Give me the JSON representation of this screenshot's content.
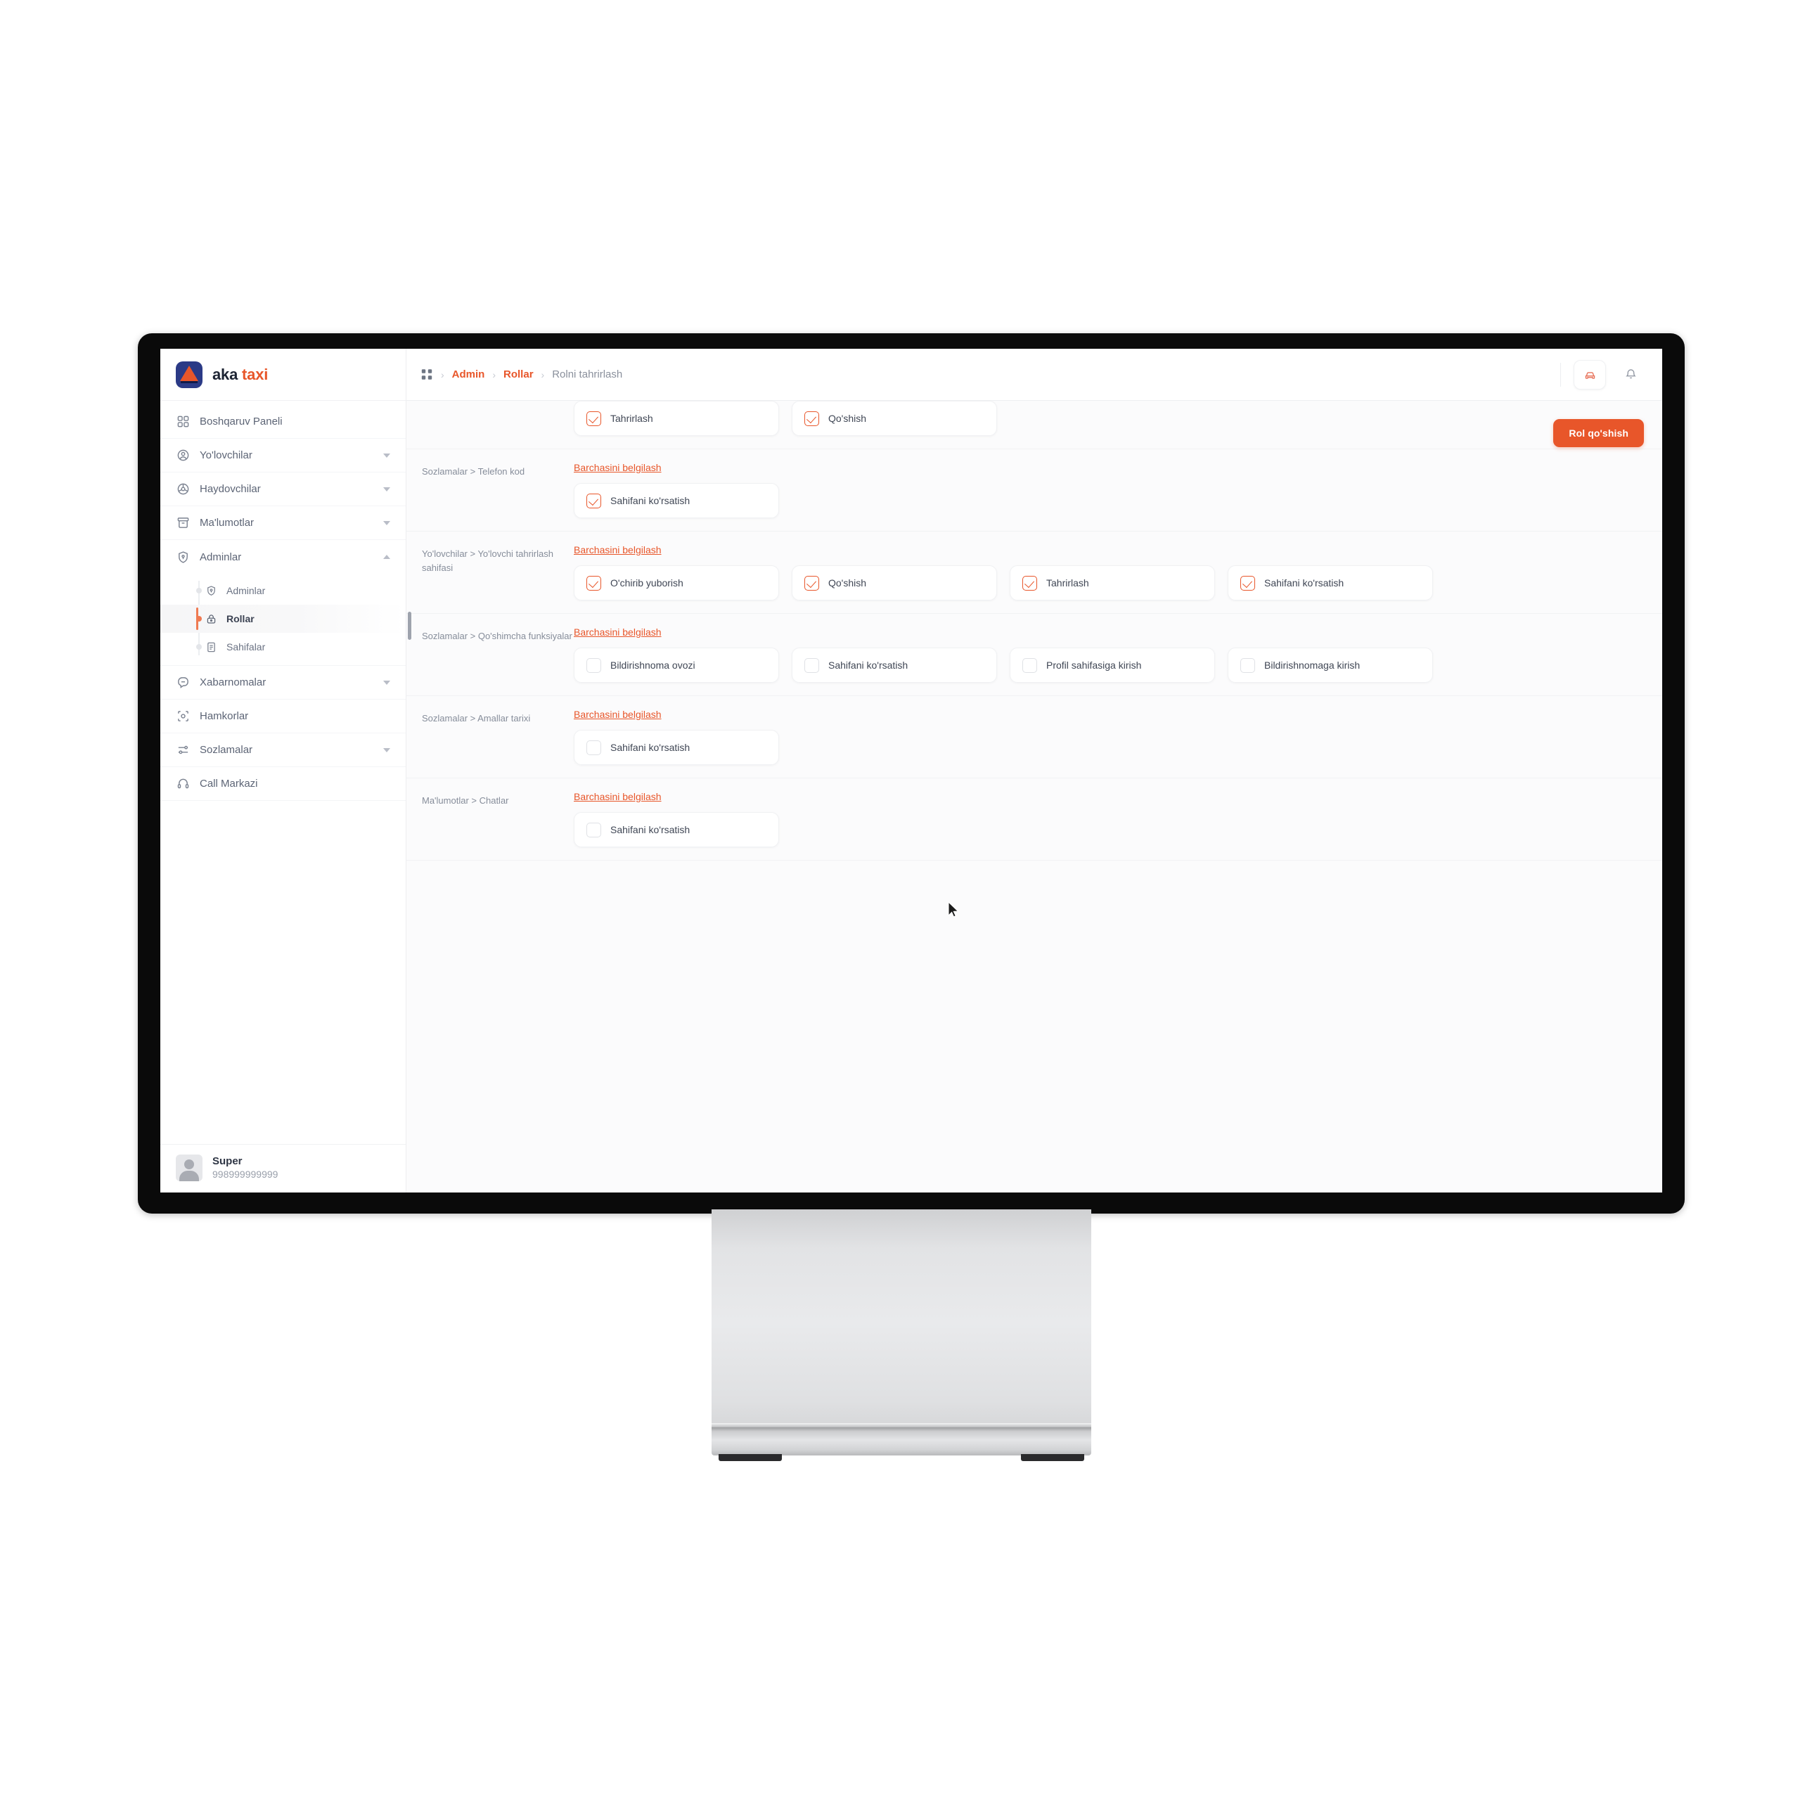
{
  "brand": {
    "word1": "aka",
    "word2": "taxi"
  },
  "sidebar": {
    "items": [
      {
        "label": "Boshqaruv Paneli",
        "icon": "grid-icon",
        "caret": "none"
      },
      {
        "label": "Yo'lovchilar",
        "icon": "user-circle-icon",
        "caret": "down"
      },
      {
        "label": "Haydovchilar",
        "icon": "steering-wheel-icon",
        "caret": "down"
      },
      {
        "label": "Ma'lumotlar",
        "icon": "archive-icon",
        "caret": "down"
      },
      {
        "label": "Adminlar",
        "icon": "shield-icon",
        "caret": "up"
      }
    ],
    "submenu": [
      {
        "label": "Adminlar",
        "icon": "shield-icon",
        "active": false
      },
      {
        "label": "Rollar",
        "icon": "lock-icon",
        "active": true
      },
      {
        "label": "Sahifalar",
        "icon": "document-icon",
        "active": false
      }
    ],
    "items_after": [
      {
        "label": "Xabarnomalar",
        "icon": "message-icon",
        "caret": "down"
      },
      {
        "label": "Hamkorlar",
        "icon": "partners-icon",
        "caret": "none"
      },
      {
        "label": "Sozlamalar",
        "icon": "sliders-icon",
        "caret": "down"
      },
      {
        "label": "Call Markazi",
        "icon": "headset-icon",
        "caret": "none"
      }
    ],
    "profile": {
      "name": "Super",
      "phone": "998999999999"
    }
  },
  "topbar": {
    "breadcrumb": [
      {
        "text": "Admin",
        "type": "link"
      },
      {
        "text": "Rollar",
        "type": "link"
      },
      {
        "text": "Rolni tahrirlash",
        "type": "current"
      }
    ],
    "separator": "›",
    "grid_icon": "grid-icon",
    "car_icon": "car-icon",
    "bell_icon": "bell-icon"
  },
  "main": {
    "add_role_button": "Rol qo'shish",
    "select_all_label": "Barchasini belgilash",
    "partial_row": {
      "permissions": [
        {
          "label": "Tahrirlash",
          "checked": true
        },
        {
          "label": "Qo'shish",
          "checked": true
        }
      ]
    },
    "sections": [
      {
        "title": "Sozlamalar > Telefon kod",
        "permissions": [
          {
            "label": "Sahifani ko'rsatish",
            "checked": true
          }
        ]
      },
      {
        "title": "Yo'lovchilar > Yo'lovchi tahrirlash sahifasi",
        "permissions": [
          {
            "label": "O'chirib yuborish",
            "checked": true
          },
          {
            "label": "Qo'shish",
            "checked": true
          },
          {
            "label": "Tahrirlash",
            "checked": true
          },
          {
            "label": "Sahifani ko'rsatish",
            "checked": true
          }
        ]
      },
      {
        "title": "Sozlamalar > Qo'shimcha funksiyalar",
        "permissions": [
          {
            "label": "Bildirishnoma ovozi",
            "checked": false
          },
          {
            "label": "Sahifani ko'rsatish",
            "checked": false
          },
          {
            "label": "Profil sahifasiga kirish",
            "checked": false
          },
          {
            "label": "Bildirishnomaga kirish",
            "checked": false
          }
        ]
      },
      {
        "title": "Sozlamalar > Amallar tarixi",
        "permissions": [
          {
            "label": "Sahifani ko'rsatish",
            "checked": false
          }
        ]
      },
      {
        "title": "Ma'lumotlar > Chatlar",
        "permissions": [
          {
            "label": "Sahifani ko'rsatish",
            "checked": false
          }
        ]
      }
    ]
  },
  "colors": {
    "accent": "#e8562a",
    "brand_navy": "#2b3a86",
    "text": "#3f4654",
    "muted": "#868d9a"
  }
}
